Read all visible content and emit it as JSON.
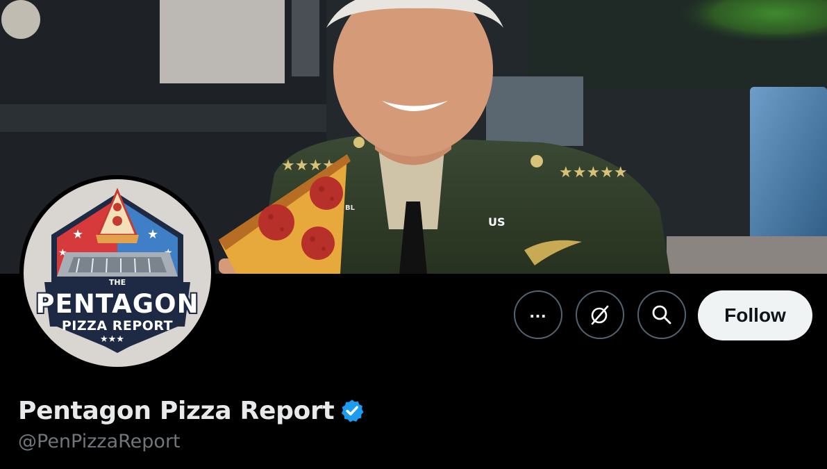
{
  "profile": {
    "display_name": "Pentagon Pizza Report",
    "handle": "@PenPizzaReport",
    "verified": true
  },
  "avatar": {
    "logo_small_text": "THE",
    "logo_title": "PENTAGON",
    "logo_subtitle": "PIZZA REPORT"
  },
  "banner": {
    "uniform_badge_text": "US",
    "collar_tag_text": "BL"
  },
  "actions": {
    "more_icon": "more-icon",
    "grok_icon": "grok-icon",
    "search_icon": "search-icon",
    "follow_label": "Follow"
  },
  "colors": {
    "background": "#000000",
    "follow_button_bg": "#eff3f4",
    "verified_blue": "#1d9bf0",
    "handle_gray": "#71767b",
    "button_border": "#536471"
  }
}
